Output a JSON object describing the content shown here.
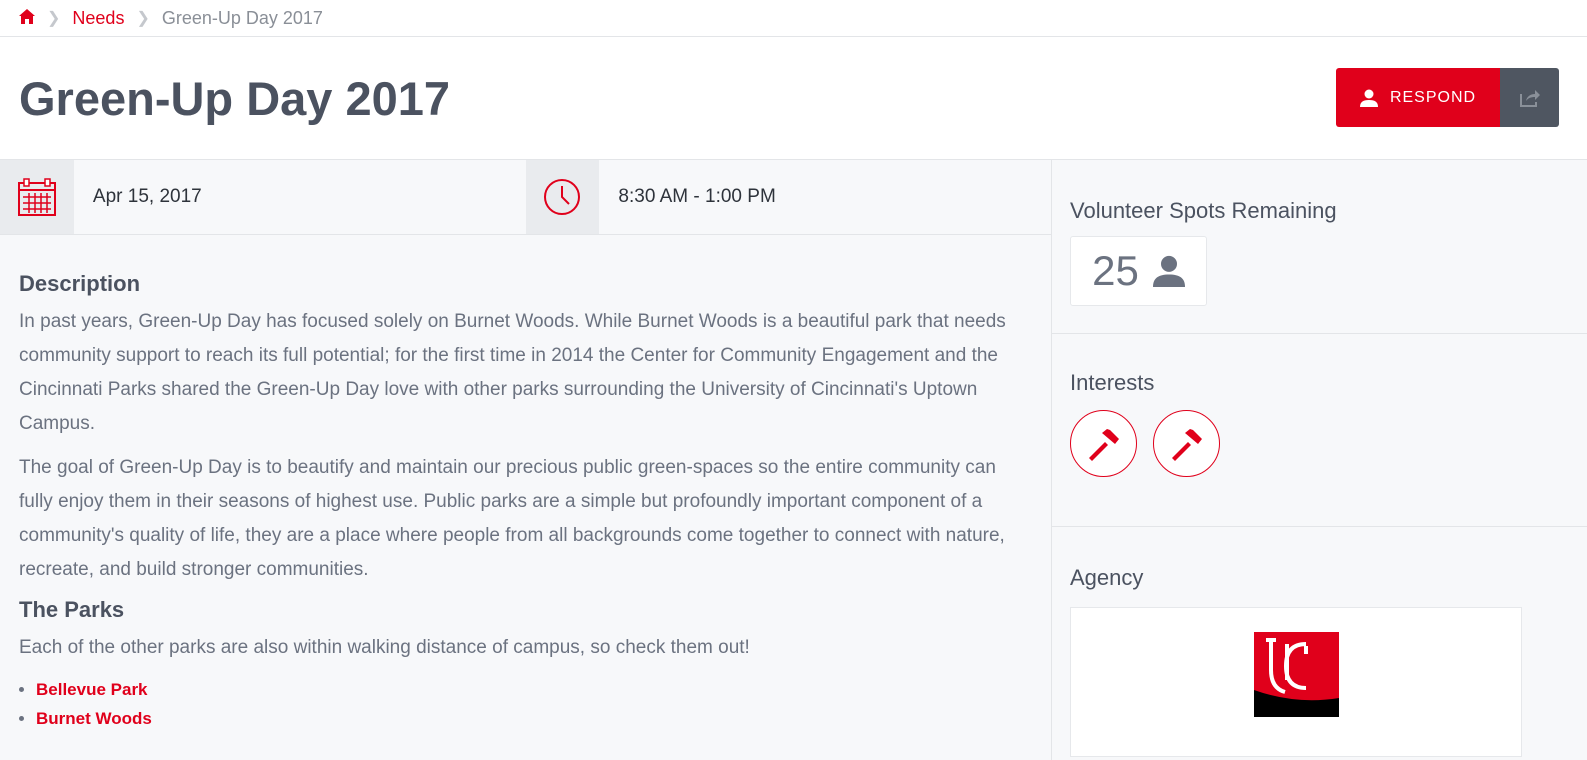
{
  "breadcrumb": {
    "home": "home",
    "needs": "Needs",
    "current": "Green-Up Day 2017"
  },
  "header": {
    "title": "Green-Up Day 2017",
    "respond": "RESPOND"
  },
  "meta": {
    "date": "Apr 15, 2017",
    "time": "8:30 AM - 1:00 PM"
  },
  "description": {
    "heading": "Description",
    "paragraphs": [
      "In past years, Green-Up Day has focused solely on Burnet Woods. While Burnet Woods is a beautiful park that needs community support to reach its full potential; for the first time in 2014 the Center for Community Engagement and the Cincinnati Parks shared the Green-Up Day love with other parks surrounding the University of Cincinnati's Uptown Campus.",
      "The goal of Green-Up Day is to beautify and maintain our precious public green-spaces so the entire community can fully enjoy them in their seasons of highest use. Public parks are a simple but profoundly important component of a community's quality of life, they are a place where people from all backgrounds come together to connect with nature, recreate, and build stronger communities."
    ]
  },
  "parks": {
    "heading": "The Parks",
    "intro": "Each of the other parks are also within walking distance of campus, so check them out!",
    "items": [
      "Bellevue Park",
      "Burnet Woods"
    ]
  },
  "sidebar": {
    "spots_heading": "Volunteer Spots Remaining",
    "spots": "25",
    "interests_heading": "Interests",
    "interests": [
      "hammer-icon",
      "hammer-icon"
    ],
    "agency_heading": "Agency",
    "agency_logo": "UC"
  },
  "colors": {
    "accent": "#e0001b",
    "dark": "#4f5661"
  }
}
